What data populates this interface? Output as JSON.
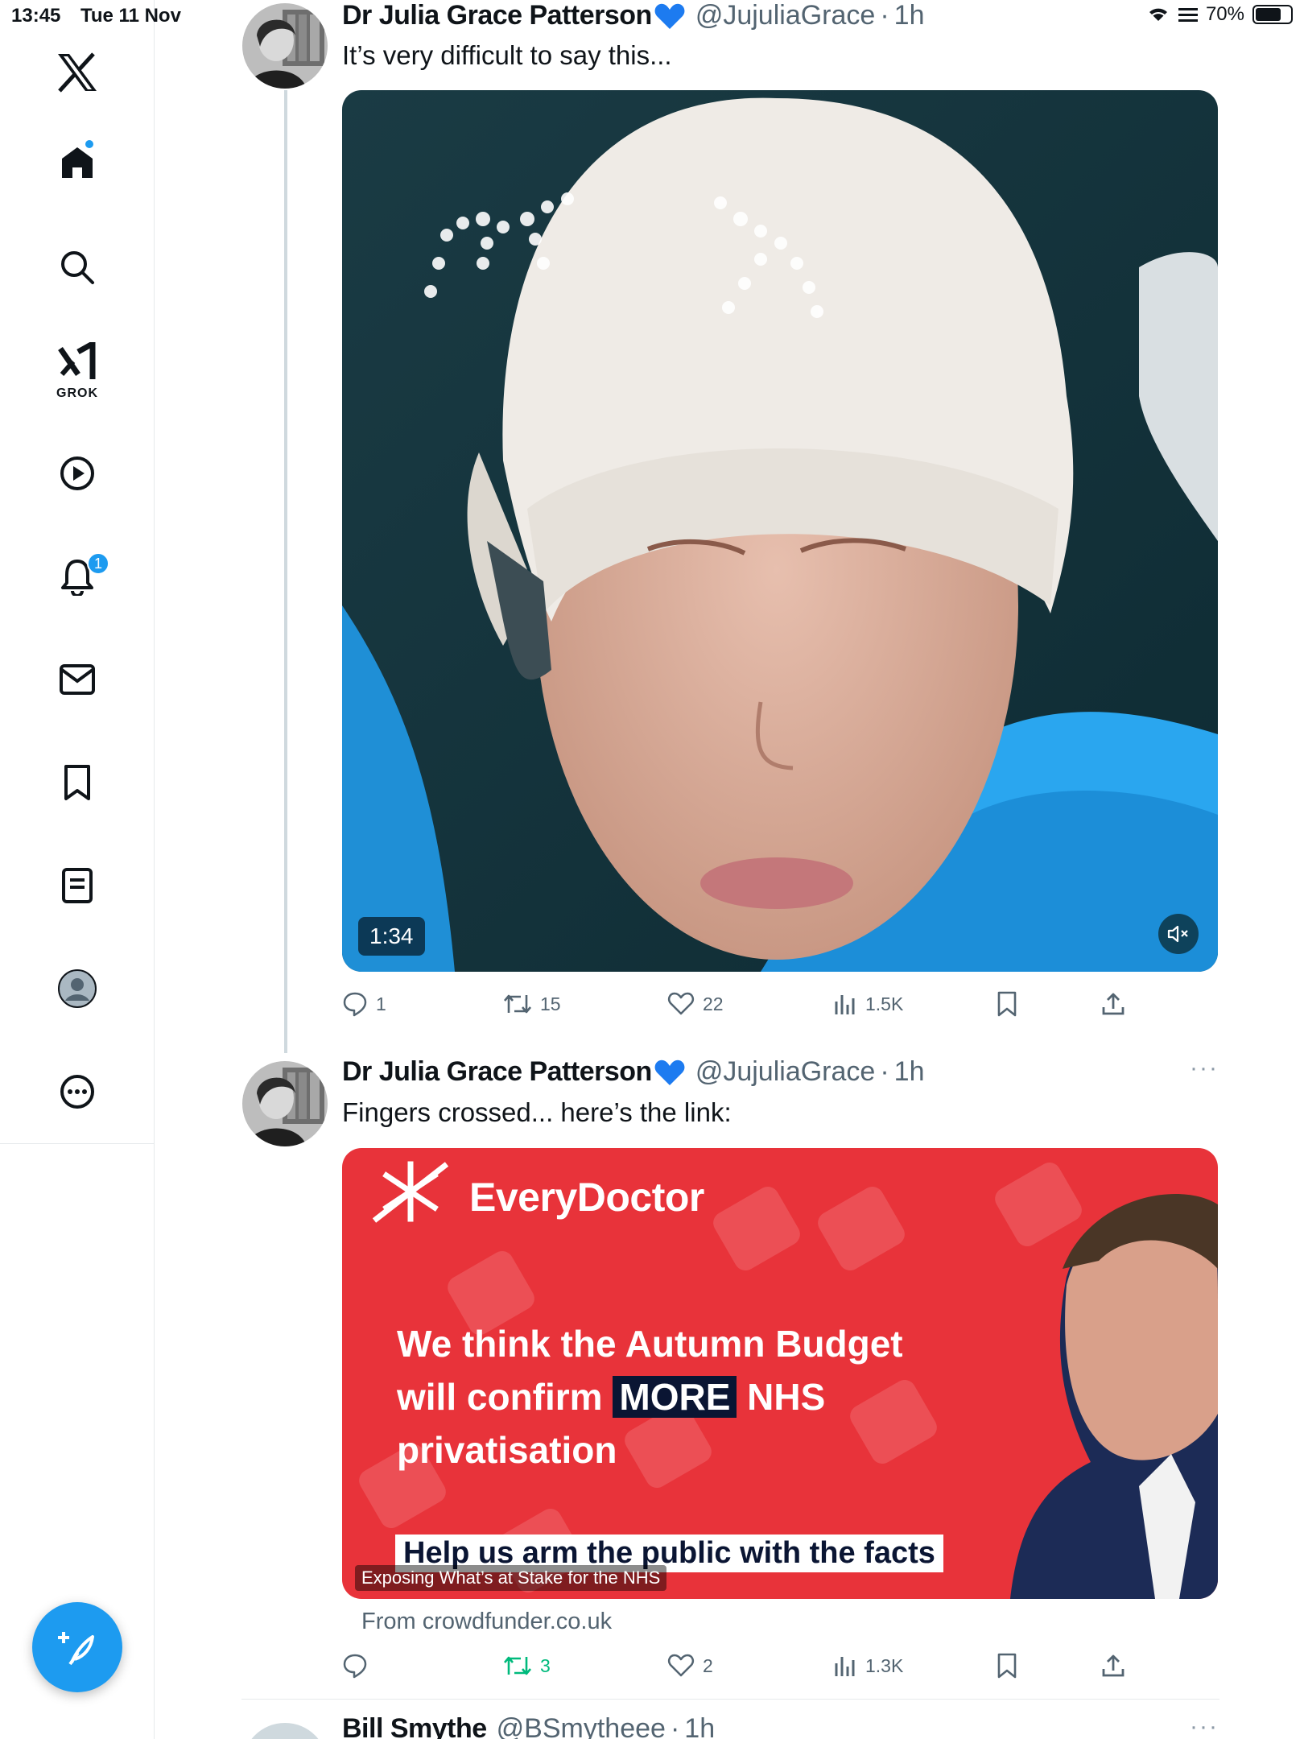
{
  "status_bar": {
    "time": "13:45",
    "date": "Tue 11 Nov",
    "battery": "70%",
    "battery_level": 0.7
  },
  "sidebar": {
    "grok_label": "GROK",
    "notifications_badge": "1",
    "items": [
      "x-logo",
      "home-icon",
      "search-icon",
      "grok-icon",
      "video-icon",
      "bell-icon",
      "mail-icon",
      "bookmark-icon",
      "lists-icon",
      "profile-icon",
      "more-icon"
    ]
  },
  "posts": [
    {
      "name": "Dr Julia Grace Patterson",
      "handle": "@JujuliaGrace",
      "sep": "·",
      "time": "1h",
      "text": "It’s very difficult to say this...",
      "video": {
        "duration": "1:34"
      },
      "actions": {
        "replies": "1",
        "reposts": "15",
        "likes": "22",
        "views": "1.5K"
      }
    },
    {
      "name": "Dr Julia Grace Patterson",
      "handle": "@JujuliaGrace",
      "sep": "·",
      "time": "1h",
      "text": "Fingers crossed... here’s the link:",
      "card": {
        "brand": "EveryDoctor",
        "headline_1": "We think the Autumn Budget",
        "headline_2a": "will confirm ",
        "headline_2b": "MORE",
        "headline_2c": " NHS",
        "headline_3": "privatisation",
        "banner": "Help us arm the public with the facts",
        "caption": "Exposing What’s at Stake for the NHS",
        "source": "From crowdfunder.co.uk"
      },
      "actions": {
        "replies": "",
        "reposts": "3",
        "likes": "2",
        "views": "1.3K"
      }
    },
    {
      "name": "Bill Smythe",
      "handle": "@BSmytheee",
      "sep": "·",
      "time": "1h"
    }
  ],
  "colors": {
    "accent": "#1d9bf0",
    "repost_active": "#00ba7c",
    "card_red": "#e8333a",
    "muted": "#536471"
  }
}
